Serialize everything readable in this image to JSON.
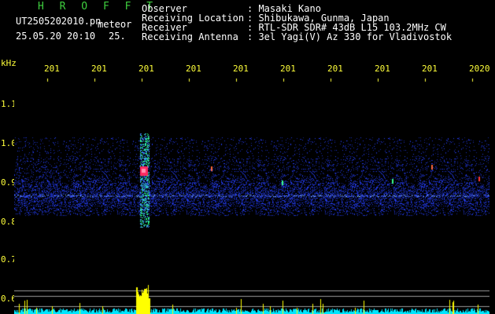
{
  "header": {
    "program": "H R O F F T",
    "filename": "UT2505202010.pn",
    "mode": "meteor",
    "datetime": "25.05.20 20:10",
    "count": "25.",
    "fields": [
      {
        "label": "Observer",
        "value": ": Masaki Kano"
      },
      {
        "label": "Receiving Location",
        "value": ": Shibukawa, Gunma, Japan"
      },
      {
        "label": "Receiver",
        "value": ": RTL-SDR SDR# 43dB L15 103.2MHz CW"
      },
      {
        "label": "Receiving Antenna",
        "value": ": 3el Yagi(V) Az 330 for Vladivostok"
      }
    ]
  },
  "axis": {
    "unit": "kHz",
    "freq_labels": [
      "1.1",
      "1.0",
      "0.9",
      "0.8",
      "0.7",
      "0.6"
    ],
    "time_labels": [
      "201",
      "201",
      "201",
      "201",
      "201",
      "201",
      "201",
      "201",
      "201",
      "2020"
    ]
  },
  "colors": {
    "background": "#000000",
    "label": "#ffff3a",
    "header_text": "#ffffff",
    "program": "#3fcf3f",
    "noise_blue": "#2a3cff",
    "signal_red": "#ff2a60",
    "histogram": "#00e6ff",
    "histogram_peak": "#ffff00"
  }
}
